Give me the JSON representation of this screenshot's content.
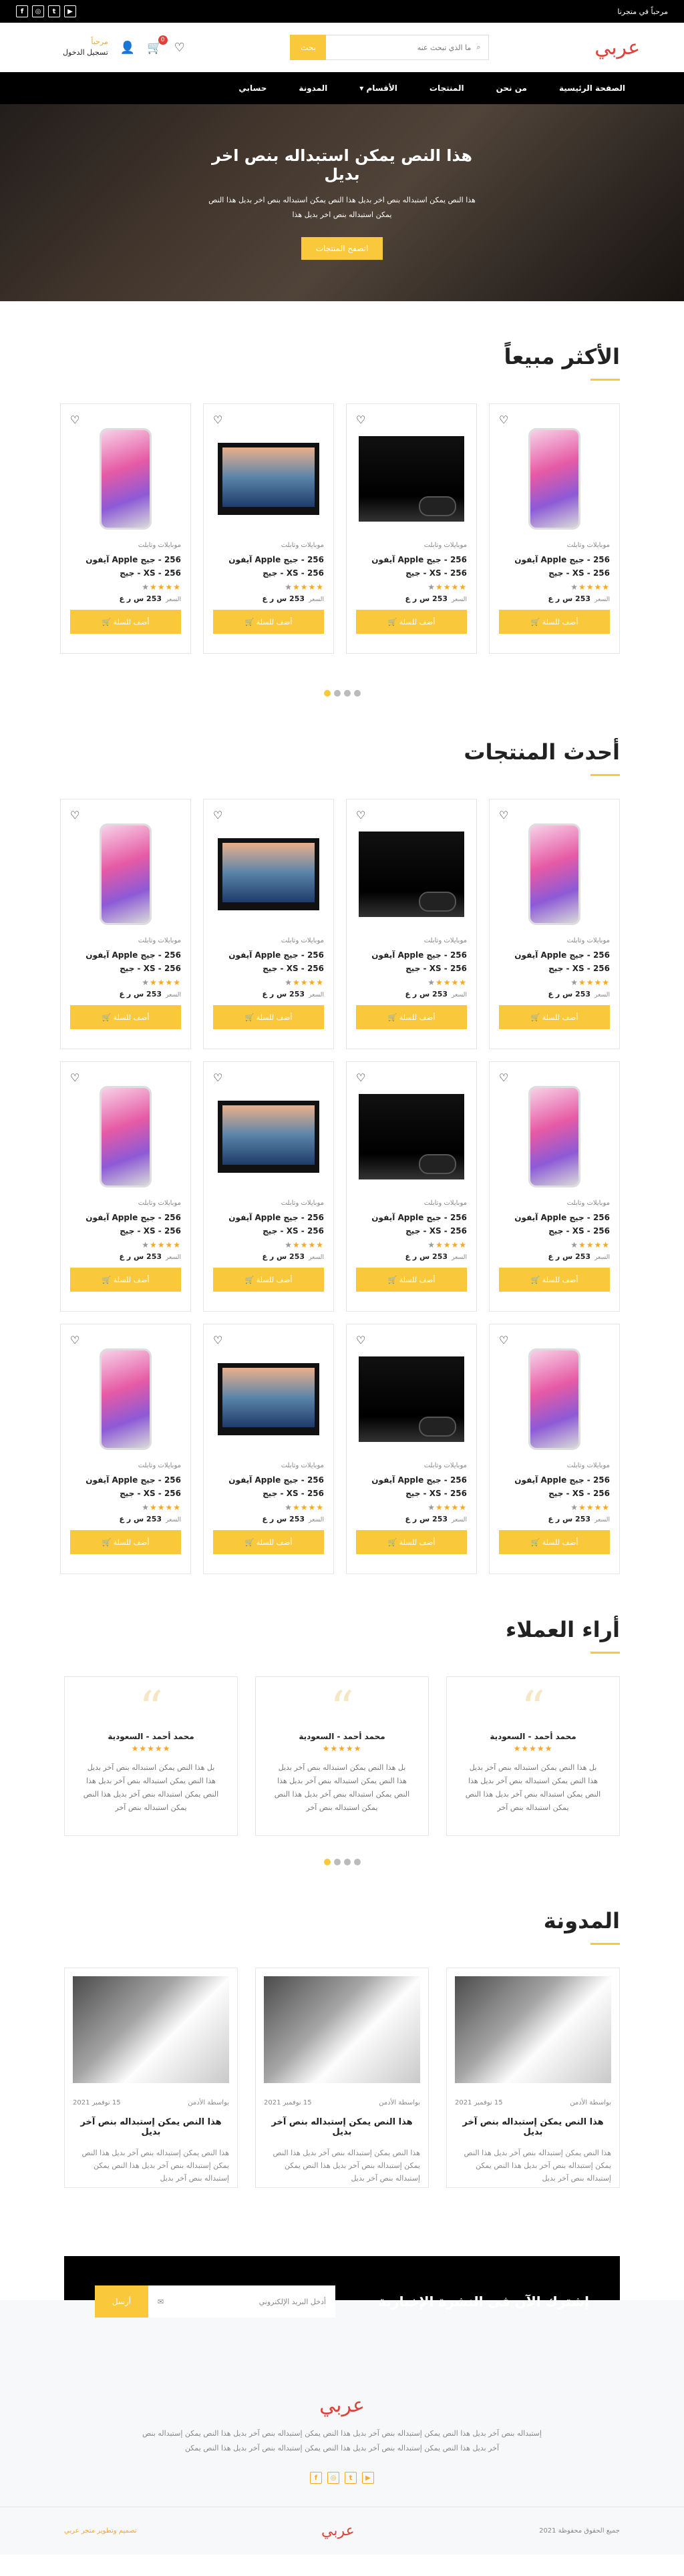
{
  "topbar": {
    "greeting": "مرحباً في متجرنا",
    "social": [
      "f",
      "◎",
      "t",
      "▶",
      "in"
    ]
  },
  "header": {
    "logo": "عربي",
    "search_placeholder": "ما الذي تبحث عنه",
    "search_button": "بحث",
    "account_hi": "مرحباً",
    "account_login": "تسجيل الدخول",
    "cart_count": "0"
  },
  "nav": [
    "الصفحة الرئيسية",
    "من نحن",
    "المنتجات",
    "الأقسام ▾",
    "المدونة",
    "حسابي"
  ],
  "hero": {
    "title": "هذا النص يمكن استبداله بنص اخر بديل",
    "text": "هذا النص يمكن استبداله بنص اخر بديل هذا النص يمكن استبداله بنص اخر بديل هذا النص يمكن استبداله بنص اخر بديل هذا",
    "button": "اتصفح المنتجات"
  },
  "bestsellers": {
    "title": "الأكثر مبيعاً"
  },
  "latest": {
    "title": "أحدث المنتجات"
  },
  "product": {
    "category": "موبايلات وتابلت",
    "name": "256 - جيج Apple آيفون 256 - XS - جيج",
    "price_label": "السعر",
    "price": "253 س ر ع",
    "add": "أضف للسلة 🛒"
  },
  "product_images": {
    "bestsellers": [
      "phone",
      "ps4",
      "mac",
      "phone"
    ],
    "latest": [
      "phone",
      "ps4",
      "mac",
      "phone",
      "phone",
      "ps4",
      "mac",
      "phone",
      "phone",
      "ps4",
      "mac",
      "phone"
    ]
  },
  "reviews": {
    "title": "أراء العملاء",
    "name": "محمد أحمد - السعودية",
    "text": "بل هذا النص يمكن استبداله بنص آخر بديل هذا النص يمكن استبداله بنص آخر بديل هذا النص يمكن استبداله بنص آخر بديل هذا النص يمكن استبداله بنص آخر",
    "count": 3
  },
  "blog": {
    "title": "المدونة",
    "author": "بواسطة الأدمن",
    "date": "15 نوفمبر 2021",
    "post_title": "هذا النص يمكن إستبداله بنص آخر بديل",
    "text": "هذا النص يمكن إستبداله بنص آخر بديل هذا النص يمكن إستبداله بنص آخر بديل هذا النص يمكن إستبداله بنص آخر بديل",
    "count": 3
  },
  "newsletter": {
    "title": "إشترك الآن فى النشرة الإخبارية",
    "placeholder": "أدخل البريد الإلكتروني",
    "button": "أرسل"
  },
  "footer": {
    "logo": "عربي",
    "text": "إستبداله بنص آخر بديل هذا النص يمكن إستبداله بنص آخر بديل هذا النص يمكن إستبداله بنص آخر بديل هذا النص يمكن إستبداله بنص آخر بديل هذا النص يمكن إستبداله بنص آخر بديل هذا النص يمكن إستبداله بنص آخر بديل هذا النص يمكن",
    "copyright": "جميع الحقوق محفوظة 2021",
    "made_by": "تصميم وتطوير متجر عربي"
  },
  "colors": {
    "accent": "#f9c83b",
    "brand": "#e0423b"
  }
}
